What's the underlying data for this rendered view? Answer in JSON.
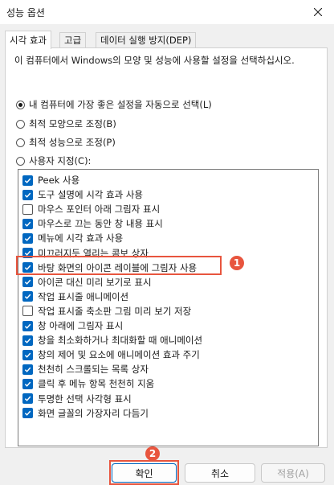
{
  "window": {
    "title": "성능 옵션"
  },
  "tabs": [
    {
      "label": "시각 효과",
      "active": true
    },
    {
      "label": "고급",
      "active": false
    },
    {
      "label": "데이터 실행 방지(DEP)",
      "active": false
    }
  ],
  "description": "이 컴퓨터에서 Windows의 모양 및 성능에 사용할 설정을 선택하십시오.",
  "radio_options": [
    {
      "label": "내 컴퓨터에 가장 좋은 설정을 자동으로 선택(L)",
      "selected": true
    },
    {
      "label": "최적 모양으로 조정(B)",
      "selected": false
    },
    {
      "label": "최적 성능으로 조정(P)",
      "selected": false
    },
    {
      "label": "사용자 지정(C):",
      "selected": false
    }
  ],
  "effects": [
    {
      "label": "Peek 사용",
      "checked": true
    },
    {
      "label": "도구 설명에 시각 효과 사용",
      "checked": true
    },
    {
      "label": "마우스 포인터 아래 그림자 표시",
      "checked": false
    },
    {
      "label": "마우스로 끄는 동안 창 내용 표시",
      "checked": true
    },
    {
      "label": "메뉴에 시각 효과 사용",
      "checked": true
    },
    {
      "label": "미끄러지듯 열리는 콤보 상자",
      "checked": true
    },
    {
      "label": "바탕 화면의 아이콘 레이블에 그림자 사용",
      "checked": true
    },
    {
      "label": "아이콘 대신 미리 보기로 표시",
      "checked": true
    },
    {
      "label": "작업 표시줄 애니메이션",
      "checked": true
    },
    {
      "label": "작업 표시줄 축소판 그림 미리 보기 저장",
      "checked": false
    },
    {
      "label": "창 아래에 그림자 표시",
      "checked": true
    },
    {
      "label": "창을 최소화하거나 최대화할 때 애니메이션",
      "checked": true
    },
    {
      "label": "창의 제어 및 요소에 애니메이션 효과 주기",
      "checked": true
    },
    {
      "label": "천천히 스크롤되는 목록 상자",
      "checked": true
    },
    {
      "label": "클릭 후 메뉴 항목 천천히 지움",
      "checked": true
    },
    {
      "label": "투명한 선택 사각형 표시",
      "checked": true
    },
    {
      "label": "화면 글꼴의 가장자리 다듬기",
      "checked": true
    }
  ],
  "annotations": {
    "marker1": "1",
    "marker2": "2"
  },
  "buttons": {
    "ok": "확인",
    "cancel": "취소",
    "apply": "적용(A)"
  },
  "colors": {
    "accent": "#0067c0",
    "annotation": "#e8553e"
  }
}
